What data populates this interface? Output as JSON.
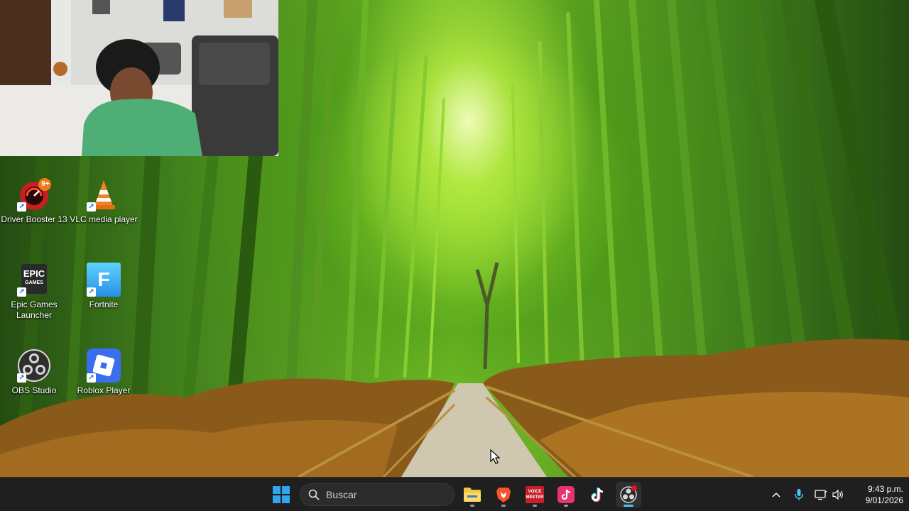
{
  "desktop": {
    "icons": [
      {
        "label": "Driver Booster 13",
        "icon": "driver-booster-icon",
        "badge": "9+"
      },
      {
        "label": "VLC media player",
        "icon": "vlc-cone-icon"
      },
      {
        "label": "Epic Games Launcher",
        "icon": "epic-games-icon",
        "logo_line1": "EPIC",
        "logo_line2": "GAMES"
      },
      {
        "label": "Fortnite",
        "icon": "fortnite-icon",
        "logo_letter": "F"
      },
      {
        "label": "OBS Studio",
        "icon": "obs-icon"
      },
      {
        "label": "Roblox Player",
        "icon": "roblox-icon"
      }
    ]
  },
  "taskbar": {
    "search_placeholder": "Buscar",
    "pinned": [
      {
        "name": "file-explorer",
        "icon": "folder-icon",
        "running": true
      },
      {
        "name": "brave",
        "icon": "brave-lion-icon",
        "running": true
      },
      {
        "name": "voicemeeter",
        "icon": "voicemeeter-icon",
        "text_top": "VOICE",
        "text_bottom": "MEETER",
        "running": true
      },
      {
        "name": "tiktok-app",
        "icon": "tiktok-pink-icon",
        "running": true
      },
      {
        "name": "tiktok",
        "icon": "tiktok-icon",
        "running": false
      },
      {
        "name": "obs-studio",
        "icon": "obs-icon",
        "running": true,
        "active": true
      }
    ],
    "tray": {
      "icons": [
        "chevron-up-icon",
        "microphone-icon",
        "network-icon",
        "volume-icon"
      ]
    },
    "clock": {
      "time": "9:43 p.m.",
      "date": "9/01/2026"
    }
  },
  "colors": {
    "taskbar_bg": "#1f1f1f",
    "accent": "#4cc2ff",
    "windows_blue": "#2fa6f2"
  }
}
